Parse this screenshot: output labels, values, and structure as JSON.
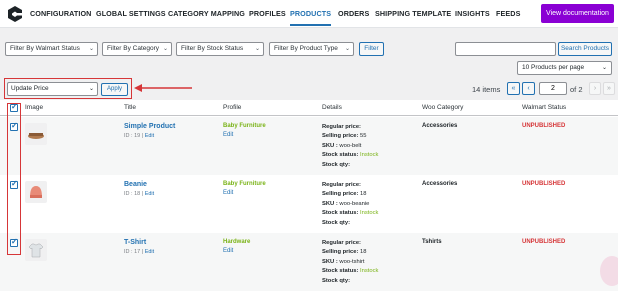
{
  "nav": {
    "items": [
      "CONFIGURATION",
      "GLOBAL SETTINGS",
      "CATEGORY MAPPING",
      "PROFILES",
      "PRODUCTS",
      "ORDERS",
      "SHIPPING TEMPLATE",
      "INSIGHTS",
      "FEEDS"
    ],
    "active": "PRODUCTS",
    "doc_button": "View documentation",
    "doc_color": "#8a00d4"
  },
  "filters": {
    "walmart_status": "Filter By Walmart Status",
    "category": "Filter By Category",
    "stock_status": "Filter By Stock Status",
    "product_type": "Filter By Product Type",
    "filter_button": "Filter",
    "search_placeholder": "",
    "search_button": "Search Products",
    "per_page": "10 Products per page"
  },
  "bulk": {
    "action": "Update Price",
    "apply": "Apply"
  },
  "pagination": {
    "items": "14 items",
    "first": "«",
    "prev": "‹",
    "current": "2",
    "of": "of 2",
    "next": "›",
    "last": "»"
  },
  "table": {
    "headers": [
      "Image",
      "Title",
      "Profile",
      "Details",
      "Woo Category",
      "Walmart Status"
    ],
    "rows": [
      {
        "title": "Simple Product",
        "id_text": "ID : 19 |",
        "edit": "Edit",
        "profile": "Baby Furniture",
        "profile_edit": "Edit",
        "regular_label": "Regular price:",
        "regular_value": "",
        "selling_label": "Selling price:",
        "selling_value": "55",
        "sku_label": "SKU :",
        "sku_value": "woo-belt",
        "stock_status_label": "Stock status:",
        "stock_status_value": "Instock",
        "stock_qty_label": "Stock qty:",
        "stock_qty_value": "",
        "category": "Accessories",
        "status": "UNPUBLISHED",
        "thumb_icon": "belt-image"
      },
      {
        "title": "Beanie",
        "id_text": "ID : 18 |",
        "edit": "Edit",
        "profile": "Baby Furniture",
        "profile_edit": "Edit",
        "regular_label": "Regular price:",
        "regular_value": "",
        "selling_label": "Selling price:",
        "selling_value": "18",
        "sku_label": "SKU :",
        "sku_value": "woo-beanie",
        "stock_status_label": "Stock status:",
        "stock_status_value": "Instock",
        "stock_qty_label": "Stock qty:",
        "stock_qty_value": "",
        "category": "Accessories",
        "status": "UNPUBLISHED",
        "thumb_icon": "beanie-image"
      },
      {
        "title": "T-Shirt",
        "id_text": "ID : 17 |",
        "edit": "Edit",
        "profile": "Hardware",
        "profile_edit": "Edit",
        "regular_label": "Regular price:",
        "regular_value": "",
        "selling_label": "Selling price:",
        "selling_value": "18",
        "sku_label": "SKU :",
        "sku_value": "woo-tshirt",
        "stock_status_label": "Stock status:",
        "stock_status_value": "Instock",
        "stock_qty_label": "Stock qty:",
        "stock_qty_value": "",
        "category": "Tshirts",
        "status": "UNPUBLISHED",
        "thumb_icon": "tshirt-image"
      }
    ]
  },
  "colors": {
    "accent": "#2271b1",
    "unpublished": "#d63638",
    "profile": "#7ab317",
    "highlight_box": "#d63638"
  }
}
